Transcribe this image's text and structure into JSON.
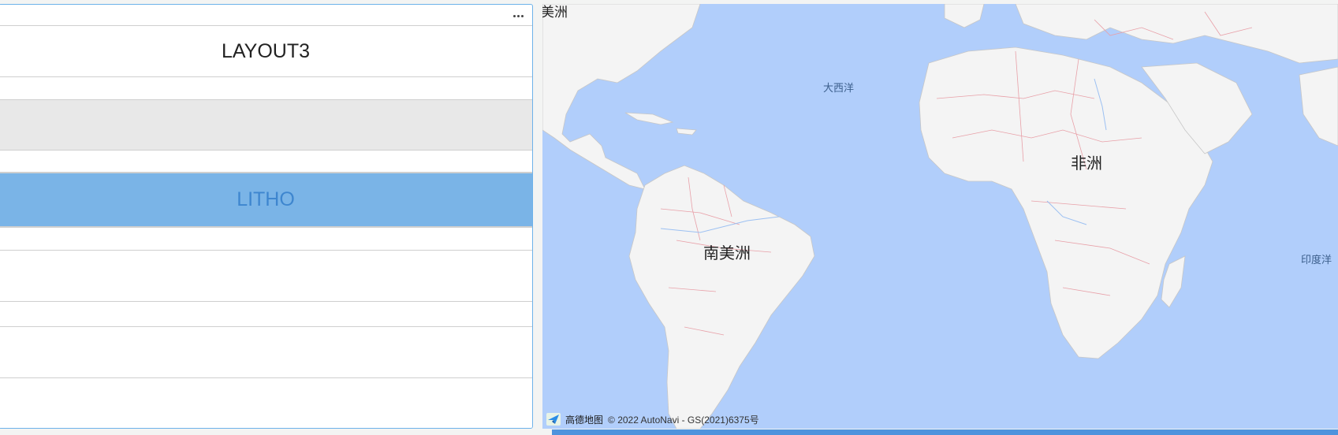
{
  "panel": {
    "menu_icon": "more-horizontal-icon",
    "rows": [
      {
        "label": "LAYOUT3"
      },
      {
        "label": ""
      },
      {
        "label": ""
      },
      {
        "label": ""
      },
      {
        "label": "LITHO"
      },
      {
        "label": ""
      },
      {
        "label": ""
      },
      {
        "label": ""
      },
      {
        "label": ""
      },
      {
        "label": ""
      }
    ]
  },
  "map": {
    "labels": {
      "north_america": "美洲",
      "atlantic": "大西洋",
      "africa": "非洲",
      "south_america": "南美洲",
      "indian_ocean": "印度洋"
    },
    "attribution": {
      "brand": "高德地图",
      "copyright": "© 2022 AutoNavi - GS(2021)6375号"
    },
    "colors": {
      "ocean": "#b1cefb",
      "land": "#f4f4f4",
      "border": "#e8a0a8",
      "accent": "#6db2ea"
    }
  }
}
